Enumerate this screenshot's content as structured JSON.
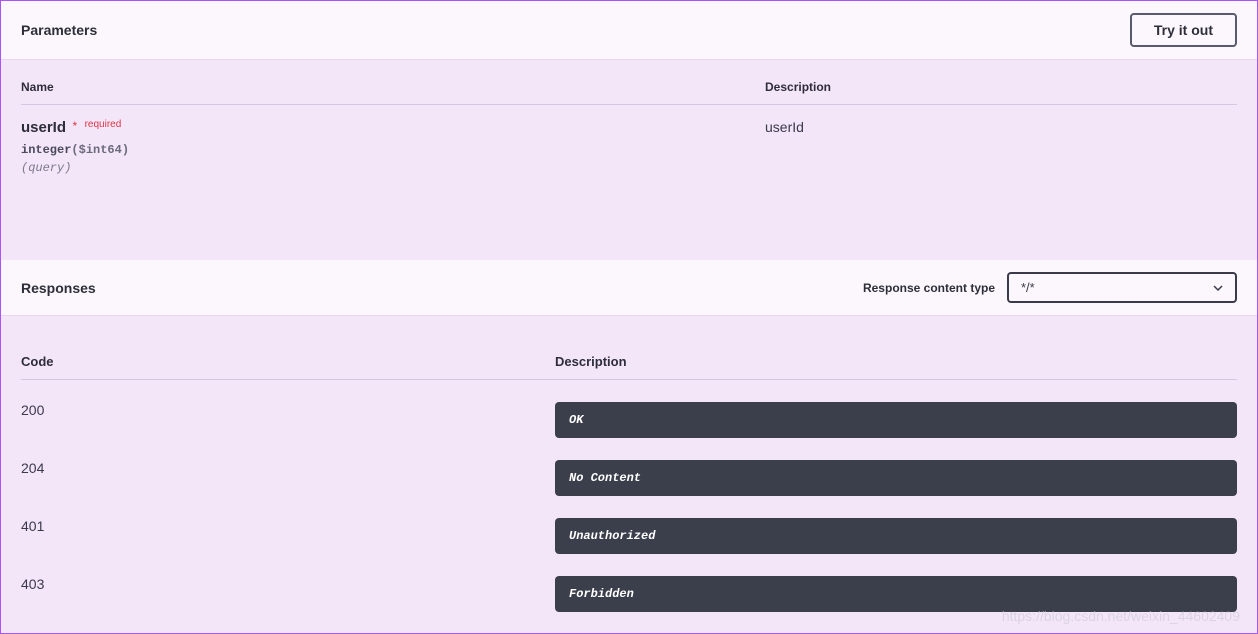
{
  "parameters": {
    "title": "Parameters",
    "tryButton": "Try it out",
    "columns": {
      "name": "Name",
      "description": "Description"
    },
    "rows": [
      {
        "name": "userId",
        "requiredStar": "*",
        "requiredLabel": "required",
        "type": "integer",
        "format": "($int64)",
        "location": "(query)",
        "description": "userId"
      }
    ]
  },
  "responses": {
    "title": "Responses",
    "contentTypeLabel": "Response content type",
    "contentTypeValue": "*/*",
    "columns": {
      "code": "Code",
      "description": "Description"
    },
    "rows": [
      {
        "code": "200",
        "description": "OK"
      },
      {
        "code": "204",
        "description": "No Content"
      },
      {
        "code": "401",
        "description": "Unauthorized"
      },
      {
        "code": "403",
        "description": "Forbidden"
      }
    ]
  },
  "watermark": "https://blog.csdn.net/weixin_44602409"
}
